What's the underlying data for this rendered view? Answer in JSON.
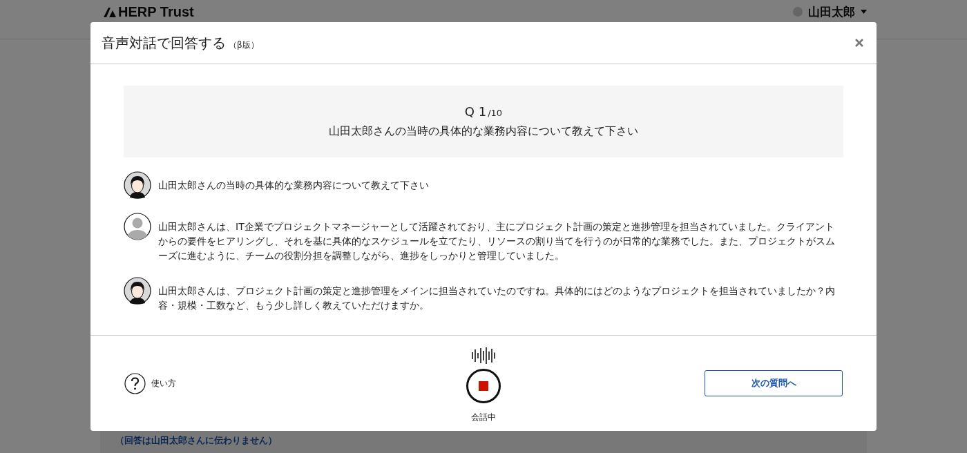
{
  "background_page": {
    "logo": "HERP Trust",
    "user_name": "山田太郎",
    "notice": "（回答は山田太郎さんに伝わりません）"
  },
  "dialog": {
    "title": "音声対話で回答する",
    "title_tag": "（β版）",
    "question": {
      "number": "Q 1",
      "total": "/10",
      "text": "山田太郎さんの当時の具体的な業務内容について教えて下さい"
    },
    "messages": [
      {
        "kind": "interviewer",
        "text": "山田太郎さんの当時の具体的な業務内容について教えて下さい"
      },
      {
        "kind": "user",
        "text": "山田太郎さんは、IT企業でプロジェクトマネージャーとして活躍されており、主にプロジェクト計画の策定と進捗管理を担当されていました。クライアントからの要件をヒアリングし、それを基に具体的なスケジュールを立てたり、リソースの割り当てを行うのが日常的な業務でした。また、プロジェクトがスムーズに進むように、チームの役割分担を調整しながら、進捗をしっかりと管理していました。"
      },
      {
        "kind": "interviewer",
        "text": "山田太郎さんは、プロジェクト計画の策定と進捗管理をメインに担当されていたのですね。具体的にはどのようなプロジェクトを担当されていましたか？内容・規模・工数など、もう少し詳しく教えていただけますか。"
      }
    ],
    "help_label": "使い方",
    "recording": true,
    "status_label": "会話中",
    "next_button": "次の質問へ"
  }
}
